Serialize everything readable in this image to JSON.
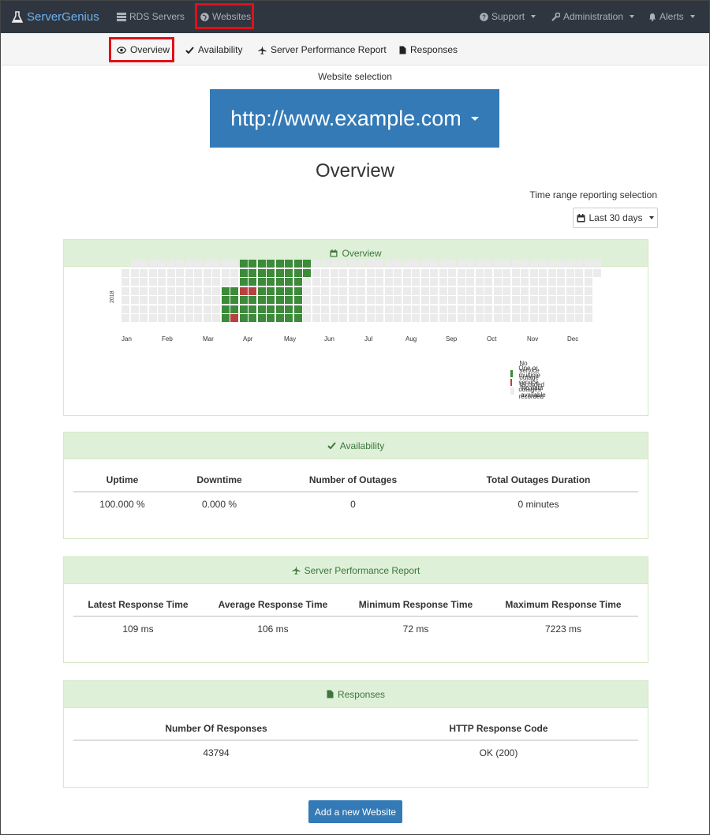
{
  "topnav": {
    "brand": "ServerGenius",
    "rds_servers": "RDS Servers",
    "websites": "Websites",
    "support": "Support",
    "administration": "Administration",
    "alerts": "Alerts"
  },
  "subnav": {
    "overview": "Overview",
    "availability": "Availability",
    "performance": "Server Performance Report",
    "responses": "Responses"
  },
  "website_selection": {
    "label": "Website selection",
    "selected": "http://www.example.com"
  },
  "page_title": "Overview",
  "time_range": {
    "label": "Time range reporting selection",
    "selected": "Last 30 days"
  },
  "overview_panel": {
    "title": "Overview",
    "year": "2018",
    "months": [
      "Jan",
      "Feb",
      "Mar",
      "Apr",
      "May",
      "Jun",
      "Jul",
      "Aug",
      "Sep",
      "Oct",
      "Nov",
      "Dec"
    ],
    "legend": {
      "ok": "No service outage recorded",
      "outage": "One or multiple service outages recorded",
      "nodata": "No data available"
    },
    "colors": {
      "ok": "#3d8a3a",
      "outage": "#b94040",
      "nodata": "#ebebeb"
    }
  },
  "availability_panel": {
    "title": "Availability",
    "headers": [
      "Uptime",
      "Downtime",
      "Number of Outages",
      "Total Outages Duration"
    ],
    "values": [
      "100.000 %",
      "0.000 %",
      "0",
      "0 minutes"
    ]
  },
  "performance_panel": {
    "title": "Server Performance Report",
    "headers": [
      "Latest Response Time",
      "Average Response Time",
      "Minimum Response Time",
      "Maximum Response Time"
    ],
    "values": [
      "109 ms",
      "106 ms",
      "72 ms",
      "7223 ms"
    ]
  },
  "responses_panel": {
    "title": "Responses",
    "headers": [
      "Number Of Responses",
      "HTTP Response Code"
    ],
    "values": [
      "43794",
      "OK (200)"
    ]
  },
  "add_website": "Add a new Website"
}
